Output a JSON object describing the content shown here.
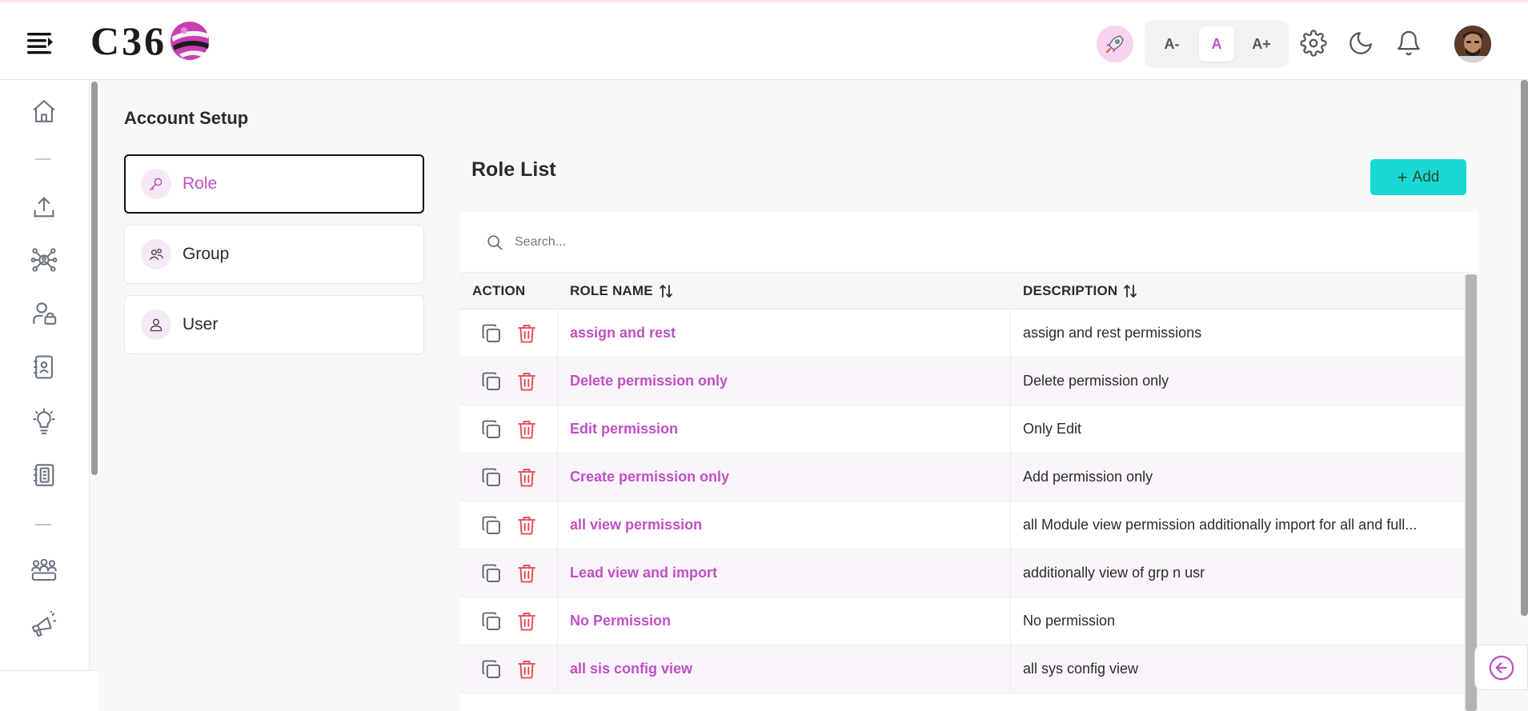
{
  "header": {
    "logo_text": "C36",
    "font_controls": [
      {
        "label": "A-",
        "active": false
      },
      {
        "label": "A",
        "active": true
      },
      {
        "label": "A+",
        "active": false
      }
    ]
  },
  "colors": {
    "accent": "#c04fc6",
    "add_button": "#19d8d3",
    "rocket_bg": "#f7d3f0"
  },
  "sidebar": {
    "icons": [
      "home-icon",
      "upload-icon",
      "network-icon",
      "user-lock-icon",
      "contact-card-icon",
      "lightbulb-icon",
      "contacts-book-icon",
      "team-icon",
      "megaphone-icon"
    ]
  },
  "page": {
    "title": "Account Setup"
  },
  "settings_menu": {
    "items": [
      {
        "label": "Role",
        "icon": "key-icon",
        "active": true
      },
      {
        "label": "Group",
        "icon": "group-icon",
        "active": false
      },
      {
        "label": "User",
        "icon": "user-icon",
        "active": false
      }
    ]
  },
  "role_list": {
    "title": "Role List",
    "add_label": "Add",
    "search_placeholder": "Search...",
    "columns": {
      "action": "ACTION",
      "role_name": "ROLE NAME",
      "description": "DESCRIPTION"
    },
    "rows": [
      {
        "name": "assign and rest",
        "description": "assign and rest permissions"
      },
      {
        "name": "Delete permission only",
        "description": "Delete permission only"
      },
      {
        "name": "Edit permission",
        "description": "Only Edit"
      },
      {
        "name": "Create permission only",
        "description": "Add permission only"
      },
      {
        "name": "all view permission",
        "description": "all Module view permission additionally import for all and full..."
      },
      {
        "name": "Lead view and import",
        "description": "additionally view of grp n usr"
      },
      {
        "name": "No Permission",
        "description": "No permission"
      },
      {
        "name": "all sis config view",
        "description": "all sys config view"
      }
    ]
  }
}
